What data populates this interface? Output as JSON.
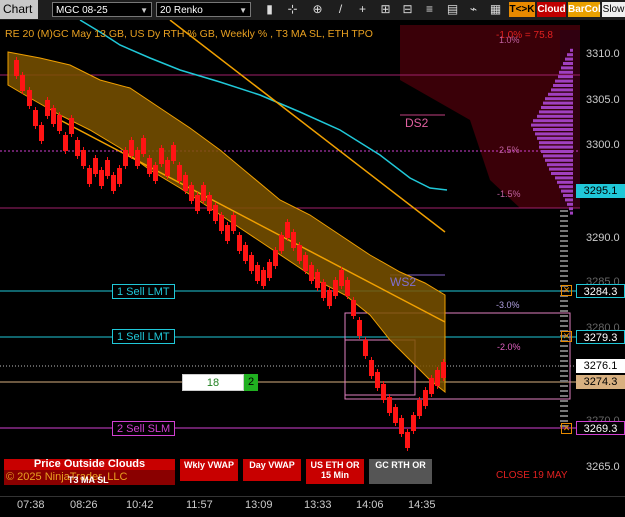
{
  "toolbar": {
    "title": "Chart",
    "instrument": "MGC 08-25",
    "bar_type": "20 Renko",
    "icons": [
      "bar-style-icon",
      "crosshair-icon",
      "zoom-icon",
      "line-tool-icon",
      "draw-icon",
      "zoom-in-icon",
      "zoom-out-icon",
      "properties-icon",
      "data-box-icon",
      "indicators-icon",
      "strategies-icon",
      "chart-trader-icon",
      "settings-icon"
    ],
    "btn_tk": "T<>K",
    "btn_cloud": "Cloud",
    "btn_barcol": "BarCol",
    "btn_slow": "Slow"
  },
  "chart": {
    "header_text": "RE 20  (M)GC May 13 GB, US Dy RTH % GB, Weekly % , T3 MA SL, ETH TPO",
    "header_color": "#e8a020",
    "top_right_label": "-1.0%  = 75.8",
    "pct_labels": [
      "1.0%",
      "2.5%",
      "-1.5%",
      "-3.0%",
      "-2.0%"
    ],
    "ds2": "DS2",
    "ws2": "WS2",
    "close_label": "CLOSE 19 MAY",
    "copyright": "© 2025 NinjaTrader, LLC"
  },
  "orders": {
    "sell_lmt_1": "1 Sell LMT",
    "sell_lmt_2": "1 Sell LMT",
    "sell_slm": "2 Sell SLM",
    "qty": "18",
    "pos": "2"
  },
  "price_axis": {
    "ticks": [
      "3310.0",
      "3305.0",
      "3300.0",
      "3290.0",
      "3285.0",
      "3280.0",
      "3270.0",
      "3265.0"
    ],
    "labels": {
      "p1": "3295.1",
      "p2": "3284.3",
      "p3": "3279.3",
      "p4": "3276.1",
      "p5": "3274.3",
      "p6": "3269.3"
    }
  },
  "time_axis": [
    "07:38",
    "08:26",
    "10:42",
    "11:57",
    "13:09",
    "13:33",
    "14:06",
    "14:35"
  ],
  "buttons": {
    "price_outside": "Price Outside Clouds",
    "t3_ma_sl": "T3 MA SL",
    "wkly_vwap": "Wkly VWAP",
    "day_vwap": "Day VWAP",
    "us_eth": "US ETH OR 15 Min",
    "gc_rth": "GC RTH OR"
  },
  "colors": {
    "bear": "#ff1010",
    "bull": "#ff1010",
    "cloud": "#8a5a00",
    "cloud_edge": "#f0a000",
    "cyan": "#20c8d8",
    "magenta": "#d040d0",
    "tpo": "#a040c0"
  }
}
